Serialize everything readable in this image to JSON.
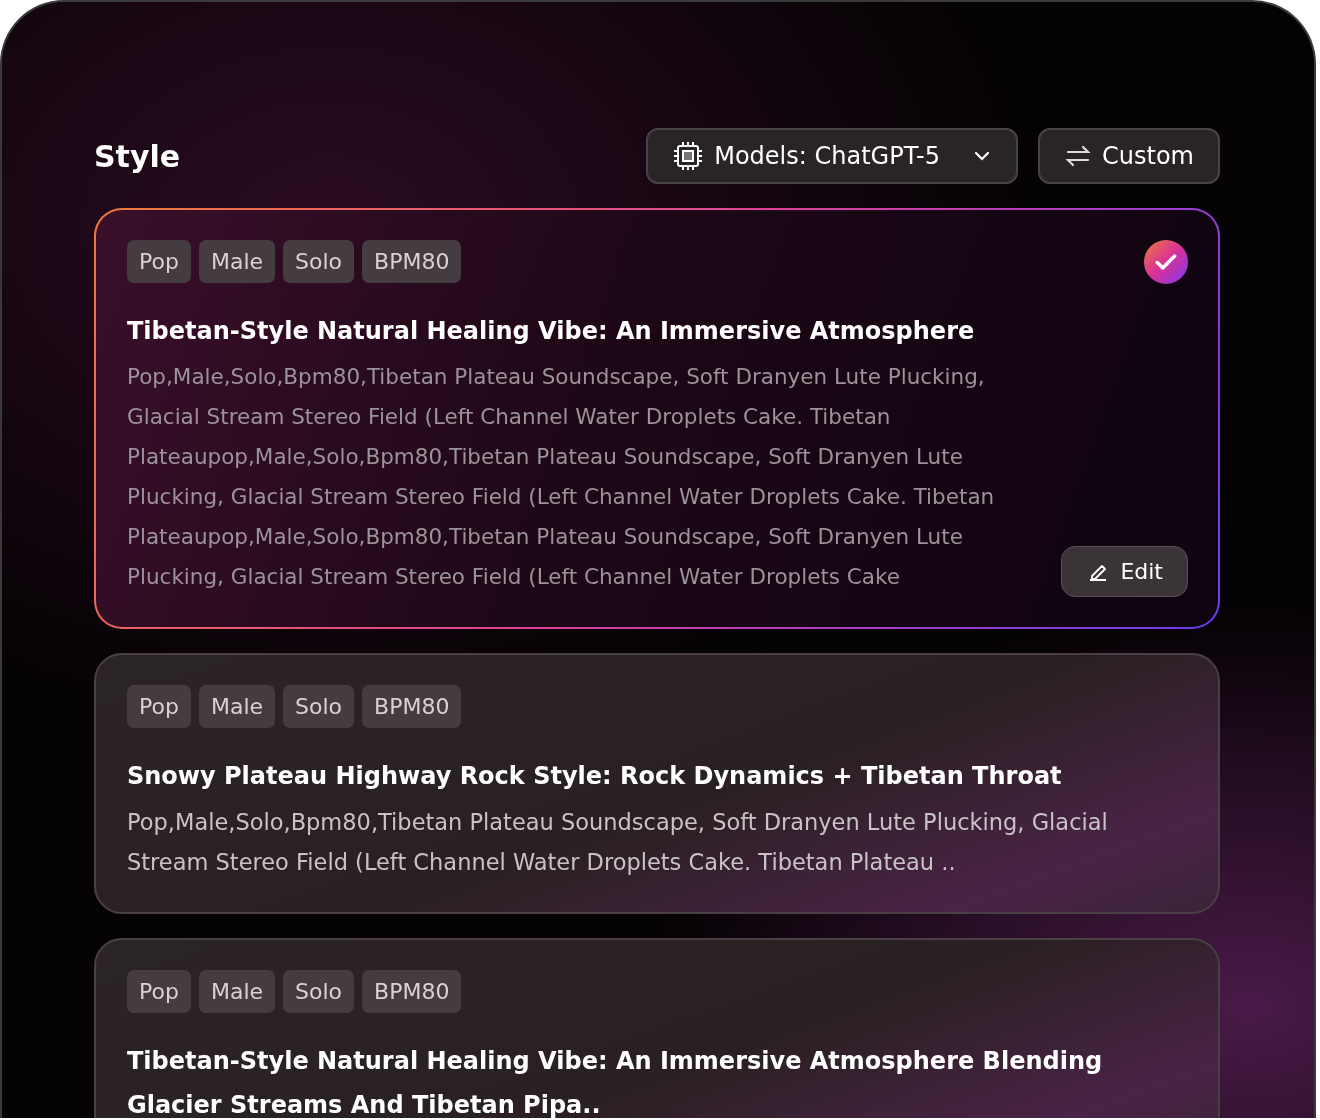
{
  "header": {
    "title": "Style",
    "model_button": "Models: ChatGPT-5",
    "custom_button": "Custom"
  },
  "cards": [
    {
      "selected": true,
      "tags": [
        "Pop",
        "Male",
        "Solo",
        "BPM80"
      ],
      "title": "Tibetan-Style Natural Healing Vibe: An Immersive Atmosphere",
      "description": "Pop,Male,Solo,Bpm80,Tibetan Plateau Soundscape, Soft Dranyen Lute Plucking, Glacial Stream Stereo Field (Left Channel Water Droplets Cake. Tibetan Plateaupop,Male,Solo,Bpm80,Tibetan Plateau Soundscape, Soft Dranyen Lute Plucking, Glacial Stream Stereo Field (Left Channel Water Droplets Cake. Tibetan Plateaupop,Male,Solo,Bpm80,Tibetan Plateau Soundscape, Soft Dranyen Lute Plucking, Glacial Stream Stereo Field (Left Channel Water Droplets Cake",
      "edit_button": "Edit"
    },
    {
      "selected": false,
      "tags": [
        "Pop",
        "Male",
        "Solo",
        "BPM80"
      ],
      "title": "Snowy Plateau Highway Rock Style: Rock Dynamics + Tibetan Throat",
      "description": "Pop,Male,Solo,Bpm80,Tibetan Plateau Soundscape, Soft Dranyen Lute Plucking, Glacial Stream Stereo Field (Left Channel Water Droplets Cake. Tibetan Plateau .."
    },
    {
      "selected": false,
      "tags": [
        "Pop",
        "Male",
        "Solo",
        "BPM80"
      ],
      "title": "Tibetan-Style Natural Healing Vibe: An Immersive Atmosphere Blending Glacier Streams And Tibetan Pipa.."
    }
  ]
}
